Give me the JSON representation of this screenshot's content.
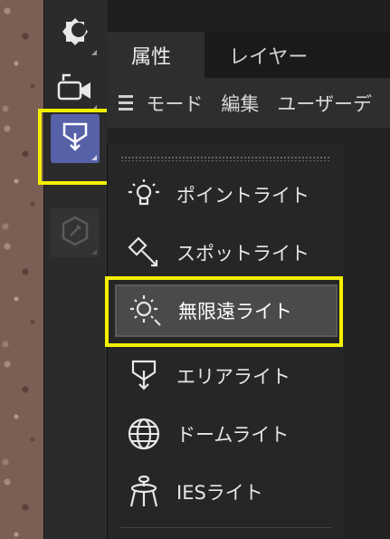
{
  "tabs": [
    {
      "label": "属性",
      "active": true
    },
    {
      "label": "レイヤー",
      "active": false
    }
  ],
  "menubar": {
    "items": [
      "モード",
      "編集",
      "ユーザーデ"
    ]
  },
  "toolbar": {
    "buttons": [
      {
        "icon": "night-sky-icon",
        "state": "normal"
      },
      {
        "icon": "camera-icon",
        "state": "normal"
      },
      {
        "icon": "light-icon",
        "state": "active"
      },
      {
        "icon": "pencil-icon",
        "state": "disabled"
      }
    ]
  },
  "dropdown": {
    "items": [
      {
        "label": "ポイントライト",
        "icon": "point-light-icon"
      },
      {
        "label": "スポットライト",
        "icon": "spot-light-icon"
      },
      {
        "label": "無限遠ライト",
        "icon": "infinite-light-icon",
        "selected": true
      },
      {
        "label": "エリアライト",
        "icon": "area-light-icon"
      },
      {
        "label": "ドームライト",
        "icon": "dome-light-icon"
      },
      {
        "label": "IESライト",
        "icon": "ies-light-icon"
      }
    ]
  },
  "colors": {
    "highlight": "#f5f000",
    "active_tool": "#5761a8",
    "selected_item": "#4a4a4a"
  }
}
